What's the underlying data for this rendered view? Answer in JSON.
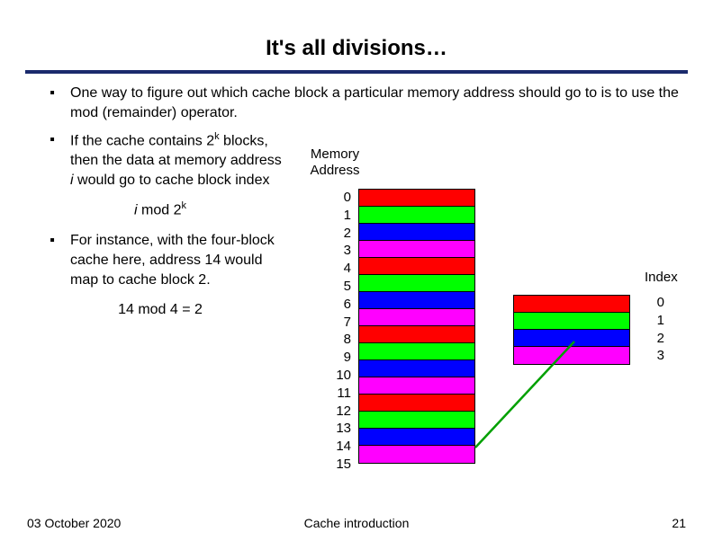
{
  "title": "It's all divisions…",
  "bullets": {
    "b1": "One way to figure out which cache block a particular memory address should go to is to use the mod (remainder) operator.",
    "b2_p1": "If the cache contains 2",
    "b2_sup": "k",
    "b2_p2": " blocks, then the data at memory address ",
    "b2_i": "i",
    "b2_p3": " would go to cache block index",
    "b3": "For instance, with the four-block cache here, address 14 would map to cache block 2."
  },
  "formula1": {
    "i": "i",
    "mid": " mod 2",
    "sup": "k"
  },
  "formula2": "14 mod 4 = 2",
  "memory": {
    "label1": "Memory",
    "label2": "Address",
    "nums": [
      "0",
      "1",
      "2",
      "3",
      "4",
      "5",
      "6",
      "7",
      "8",
      "9",
      "10",
      "11",
      "12",
      "13",
      "14",
      "15"
    ],
    "colors": [
      "red",
      "green",
      "blue",
      "magenta",
      "red",
      "green",
      "blue",
      "magenta",
      "red",
      "green",
      "blue",
      "magenta",
      "red",
      "green",
      "blue",
      "magenta"
    ]
  },
  "cache": {
    "label": "Index",
    "nums": [
      "0",
      "1",
      "2",
      "3"
    ],
    "colors": [
      "red",
      "green",
      "blue",
      "magenta"
    ]
  },
  "footer": {
    "date": "03 October 2020",
    "center": "Cache introduction",
    "page": "21"
  }
}
